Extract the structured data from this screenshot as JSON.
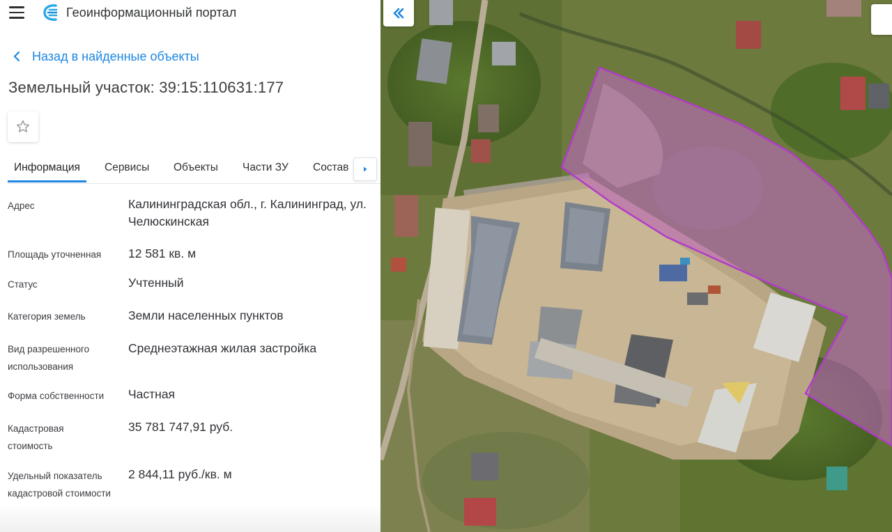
{
  "header": {
    "app_title": "Геоинформационный портал",
    "menu_icon": "menu-icon",
    "logo_icon": "portal-logo-icon"
  },
  "back_link": {
    "label": "Назад в найденные объекты",
    "icon": "chevron-left-icon"
  },
  "object": {
    "title": "Земельный участок: 39:15:110631:177"
  },
  "favorite": {
    "icon": "star-outline-icon"
  },
  "tabs": [
    {
      "label": "Информация",
      "active": true
    },
    {
      "label": "Сервисы",
      "active": false
    },
    {
      "label": "Объекты",
      "active": false
    },
    {
      "label": "Части ЗУ",
      "active": false
    },
    {
      "label": "Состав",
      "active": false
    }
  ],
  "tabs_next_icon": "caret-right-icon",
  "info": [
    {
      "label": "Адрес",
      "value": "Калининградская обл., г. Калининград, ул. Челюскинская"
    },
    {
      "label": "Площадь уточненная",
      "value": "12 581 кв. м"
    },
    {
      "label": "Статус",
      "value": "Учтенный"
    },
    {
      "label": "Категория земель",
      "value": "Земли населенных пунктов"
    },
    {
      "label": "Вид разрешенного использования",
      "value": "Среднеэтажная жилая застройка"
    },
    {
      "label": "Форма собственности",
      "value": "Частная"
    },
    {
      "label": "Кадастровая стоимость",
      "value": "35 781 747,91 руб."
    },
    {
      "label": "Удельный показатель кадастровой стоимости",
      "value": "2 844,11 руб./кв. м"
    }
  ],
  "map": {
    "collapse_icon": "double-chevron-left-icon",
    "parcel_outline_color": "#b23bc8",
    "parcel_fill_color": "#c466c8",
    "accent_color": "#1c86e0"
  }
}
